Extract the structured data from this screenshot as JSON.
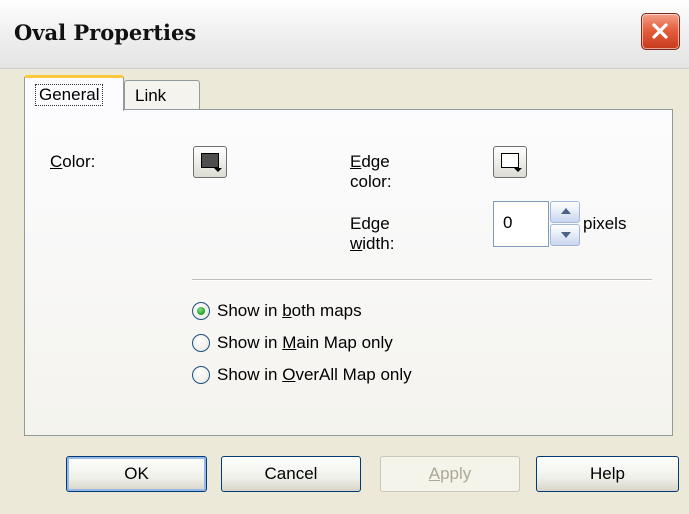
{
  "window": {
    "title": "Oval Properties"
  },
  "tabs": [
    {
      "label": "General",
      "active": true
    },
    {
      "label": "Link",
      "active": false
    }
  ],
  "general": {
    "color_label_mnemonic": "C",
    "color_label_rest": "olor:",
    "color_swatch": "#4d4d4d",
    "edge_color_label_mnemonic": "E",
    "edge_color_label_rest": "dge color:",
    "edge_color_swatch": "#ffffff",
    "edge_width_label_pre": "Edge ",
    "edge_width_label_mnemonic": "w",
    "edge_width_label_rest": "idth:",
    "edge_width_value": "0",
    "edge_width_unit": "pixels"
  },
  "visibility": [
    {
      "pre": "Show in ",
      "mnemonic": "b",
      "rest": "oth maps",
      "selected": true
    },
    {
      "pre": "Show in ",
      "mnemonic": "M",
      "rest": "ain Map only",
      "selected": false
    },
    {
      "pre": "Show in ",
      "mnemonic": "O",
      "rest": "verAll Map only",
      "selected": false
    }
  ],
  "buttons": {
    "ok": "OK",
    "cancel": "Cancel",
    "apply_mnemonic": "A",
    "apply_rest": "pply",
    "help": "Help"
  }
}
